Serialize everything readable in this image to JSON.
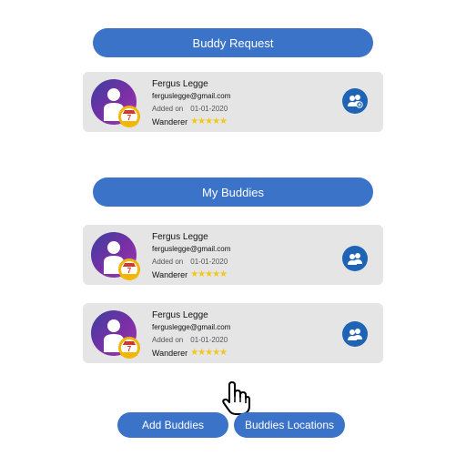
{
  "sections": {
    "requests_title": "Buddy Request",
    "buddies_title": "My Buddies"
  },
  "request": {
    "name": "Fergus Legge",
    "email": "ferguslegge@gmail.com",
    "added_label": "Added on",
    "added_date": "01-01-2020",
    "rank": "Wanderer",
    "stars": "★★★★★",
    "rating": 5
  },
  "buddies": [
    {
      "name": "Fergus Legge",
      "email": "ferguslegge@gmail.com",
      "added_label": "Added on",
      "added_date": "01-01-2020",
      "rank": "Wanderer",
      "stars": "★★★★★",
      "rating": 5
    },
    {
      "name": "Fergus Legge",
      "email": "ferguslegge@gmail.com",
      "added_label": "Added on",
      "added_date": "01-01-2020",
      "rank": "Wanderer",
      "stars": "★★★★★",
      "rating": 5
    }
  ],
  "buttons": {
    "add_buddies": "Add Buddies",
    "buddies_locations": "Buddies Locations"
  },
  "icons": {
    "avatar": "person-silhouette-icon",
    "badge": "rank-badge-icon",
    "add_buddy": "add-buddy-icon",
    "buddy_group": "buddy-group-icon",
    "cursor": "hand-pointer-icon"
  },
  "colors": {
    "primary": "#3b73c9",
    "action": "#1f63b5",
    "card": "#e5e5e5",
    "star": "#f5c518"
  }
}
